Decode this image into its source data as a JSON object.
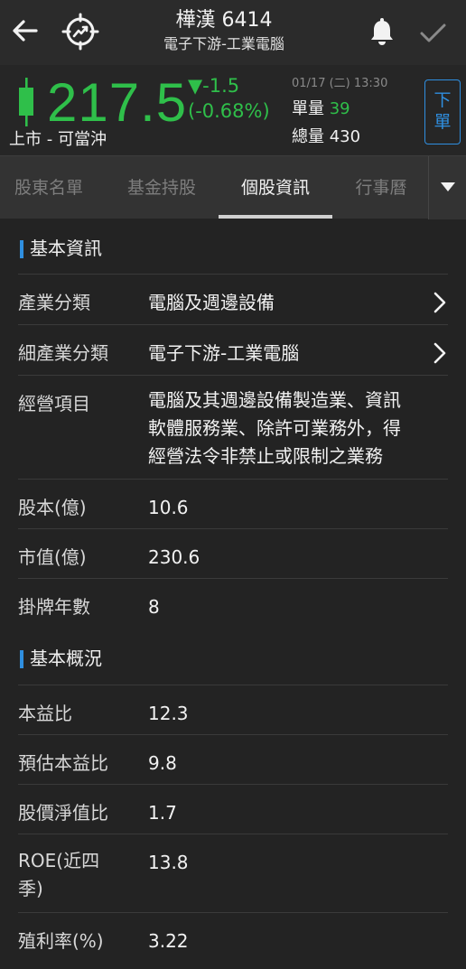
{
  "header": {
    "stock_name": "樺漢 6414",
    "sub_industry": "電子下游-工業電腦",
    "icons": {
      "back": "arrow-left-icon",
      "target": "crosshair-trend-icon",
      "alert": "bell-icon",
      "confirm": "checkmark-icon"
    }
  },
  "quote": {
    "price": "217.5",
    "change": "▼-1.5",
    "change_pct": "(-0.68%)",
    "market": "上市 - 可當沖",
    "datetime": "01/17 (二) 13:30",
    "unit_volume_label": "單量",
    "unit_volume": "39",
    "total_volume_label": "總量",
    "total_volume": "430",
    "order_button_line1": "下",
    "order_button_line2": "單",
    "up_down_color": "#2fbf4a"
  },
  "tabs": {
    "items": [
      "股東名單",
      "基金持股",
      "個股資訊",
      "行事曆"
    ],
    "active_index": 2
  },
  "basic_info": {
    "title": "基本資訊",
    "rows": [
      {
        "label": "產業分類",
        "value": "電腦及週邊設備"
      },
      {
        "label": "細產業分類",
        "value": "電子下游-工業電腦"
      },
      {
        "label": "經營項目",
        "value_lines": [
          "電腦及其週邊設備製造業、資訊",
          "軟體服務業、除許可業務外，得",
          "經營法令非禁止或限制之業務"
        ]
      },
      {
        "label": "股本(億)",
        "value": "10.6"
      },
      {
        "label": "市值(億)",
        "value": "230.6"
      },
      {
        "label": "掛牌年數",
        "value": "8"
      }
    ]
  },
  "overview": {
    "title": "基本概況",
    "rows": [
      {
        "label": "本益比",
        "value": "12.3"
      },
      {
        "label": "預估本益比",
        "value": "9.8"
      },
      {
        "label": "股價淨值比",
        "value": "1.7"
      },
      {
        "label_lines": [
          "ROE(近四",
          "季)"
        ],
        "value": "13.8"
      },
      {
        "label": "殖利率(%)",
        "value": "3.22"
      }
    ]
  },
  "accent_color": "#2f8fe0"
}
